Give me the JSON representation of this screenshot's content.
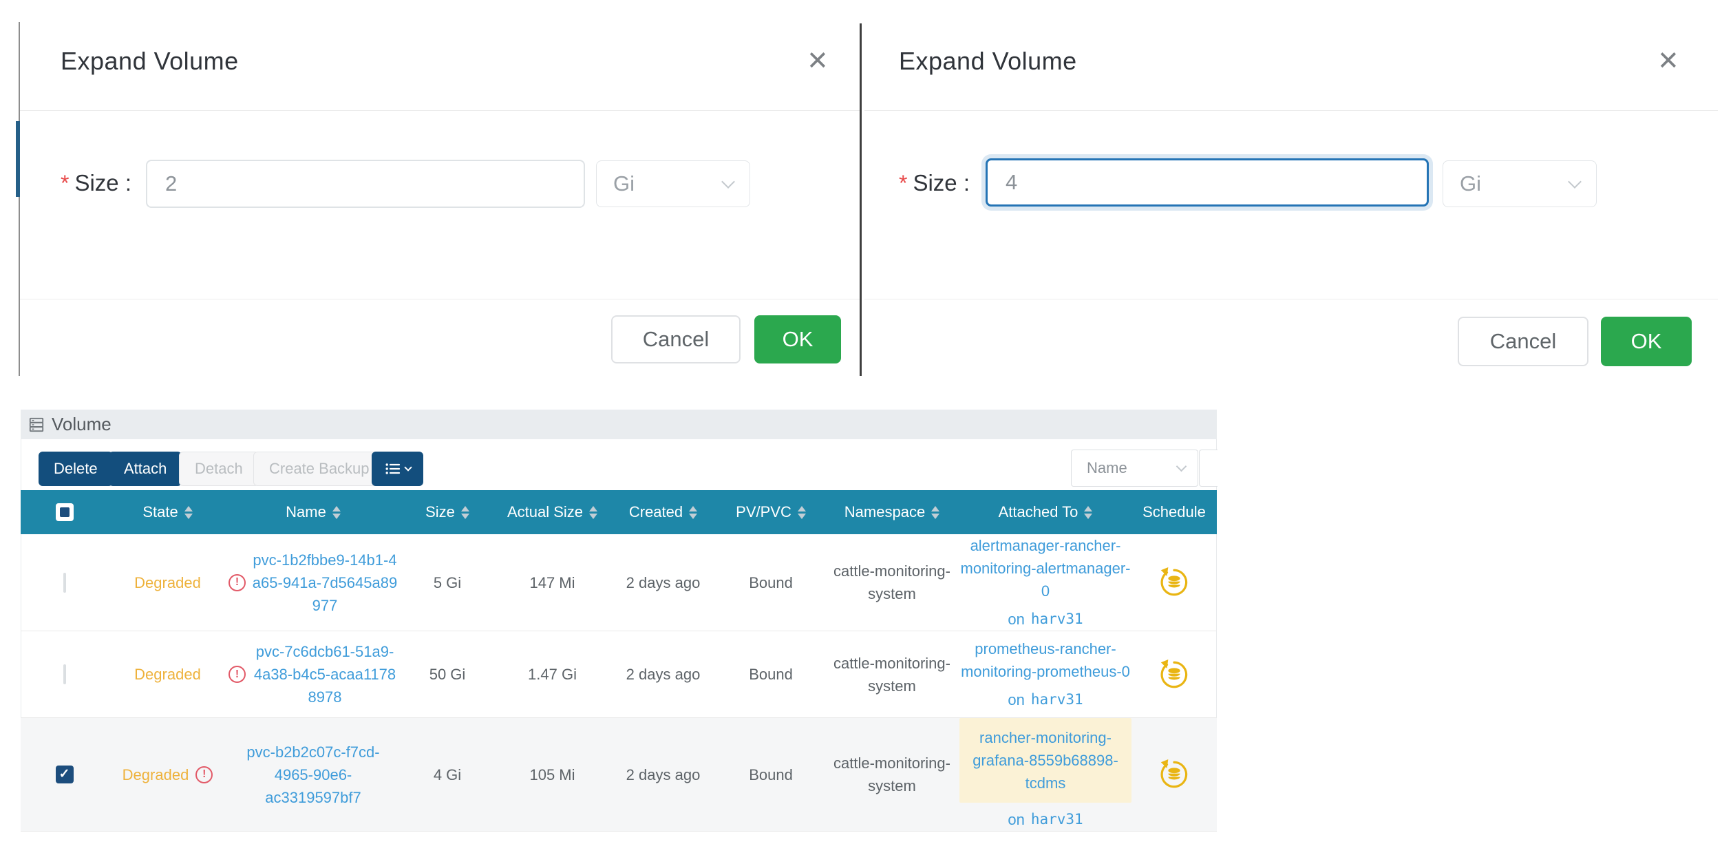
{
  "icons": {
    "close": "✕",
    "warning": "!",
    "check": "✓"
  },
  "left_modal": {
    "title": "Expand Volume",
    "required_mark": "*",
    "size_label": "Size :",
    "size_value": "2",
    "unit_value": "Gi",
    "cancel_label": "Cancel",
    "ok_label": "OK"
  },
  "right_modal": {
    "title": "Expand Volume",
    "required_mark": "*",
    "size_label": "Size :",
    "size_value": "4",
    "unit_value": "Gi",
    "cancel_label": "Cancel",
    "ok_label": "OK"
  },
  "volume": {
    "section_title": "Volume",
    "actions": {
      "delete": "Delete",
      "attach": "Attach",
      "detach": "Detach",
      "create_backup": "Create Backup"
    },
    "filter_selected": "Name",
    "columns": {
      "state": "State",
      "name": "Name",
      "size": "Size",
      "actual_size": "Actual Size",
      "created": "Created",
      "pv_pvc": "PV/PVC",
      "namespace": "Namespace",
      "attached_to": "Attached To",
      "schedule": "Schedule"
    },
    "rows": [
      {
        "checked": false,
        "state": "Degraded",
        "name": "pvc-1b2fbbe9-14b1-4a65-941a-7d5645a89977",
        "size": "5 Gi",
        "actual_size": "147 Mi",
        "created": "2 days ago",
        "pv_pvc": "Bound",
        "namespace": "cattle-monitoring-system",
        "attached_to": "alertmanager-rancher-monitoring-alertmanager-0",
        "attached_on": "on",
        "attached_host": "harv31",
        "attached_highlight": false
      },
      {
        "checked": false,
        "state": "Degraded",
        "name": "pvc-7c6dcb61-51a9-4a38-b4c5-acaa11788978",
        "size": "50 Gi",
        "actual_size": "1.47 Gi",
        "created": "2 days ago",
        "pv_pvc": "Bound",
        "namespace": "cattle-monitoring-system",
        "attached_to": "prometheus-rancher-monitoring-prometheus-0",
        "attached_on": "on",
        "attached_host": "harv31",
        "attached_highlight": false
      },
      {
        "checked": true,
        "state": "Degraded",
        "name": "pvc-b2b2c07c-f7cd-4965-90e6-ac3319597bf7",
        "size": "4 Gi",
        "actual_size": "105 Mi",
        "created": "2 days ago",
        "pv_pvc": "Bound",
        "namespace": "cattle-monitoring-system",
        "attached_to": "rancher-monitoring-grafana-8559b68898-tcdms",
        "attached_on": "on",
        "attached_host": "harv31",
        "attached_highlight": true
      }
    ]
  },
  "colors": {
    "header_teal": "#1e87a8",
    "primary_navy": "#134e7d",
    "ok_green": "#2ba84e",
    "link_blue": "#3f9cda",
    "degraded_gold": "#eeb23c",
    "warning_red": "#e25a68",
    "schedule_gold": "#e9b513",
    "focus_blue": "#2474b5",
    "highlight_yellow": "#fbf2d6"
  }
}
